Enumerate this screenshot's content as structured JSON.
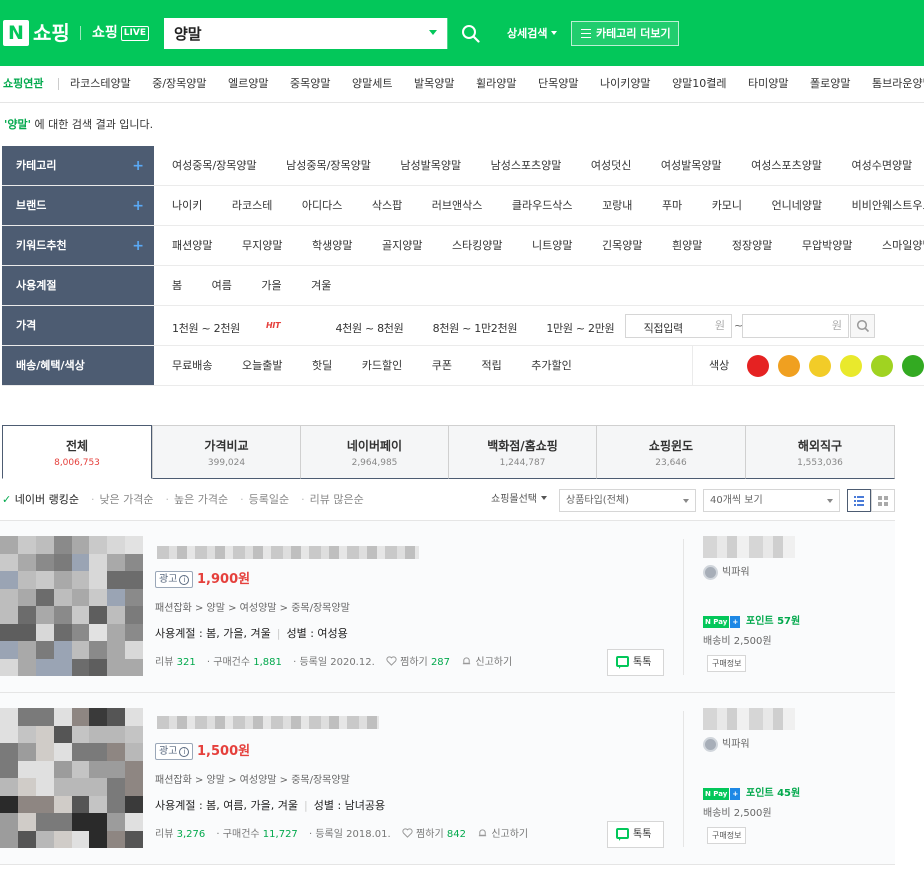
{
  "header": {
    "logo_n": "N",
    "logo_shopping": "쇼핑",
    "logo_live_text": "쇼핑",
    "logo_live_badge": "LIVE",
    "search_value": "양말",
    "detail_search": "상세검색",
    "category_more": "카테고리 더보기",
    "accent_color": "#03c75a"
  },
  "related": {
    "label": "쇼핑연관",
    "items": [
      "라코스테양말",
      "중/장목양말",
      "엘르양말",
      "중목양말",
      "양말세트",
      "발목양말",
      "휠라양말",
      "단목양말",
      "나이키양말",
      "양말10켤레",
      "타미양말",
      "폴로양말",
      "톰브라운양말"
    ]
  },
  "result": {
    "keyword": "'양말'",
    "suffix": " 에 대한 검색 결과 입니다."
  },
  "filter": {
    "category": {
      "label": "카테고리",
      "items": [
        "여성중목/장목양말",
        "남성중목/장목양말",
        "남성발목양말",
        "남성스포츠양말",
        "여성덧신",
        "여성발목양말",
        "여성스포츠양말",
        "여성수면양말"
      ]
    },
    "brand": {
      "label": "브랜드",
      "items": [
        "나이키",
        "라코스테",
        "아디다스",
        "삭스팝",
        "러브앤삭스",
        "클라우드삭스",
        "꼬랑내",
        "푸마",
        "카모니",
        "언니네양말",
        "비비안웨스트우드"
      ]
    },
    "keyword": {
      "label": "키워드추천",
      "items": [
        "패션양말",
        "무지양말",
        "학생양말",
        "골지양말",
        "스타킹양말",
        "니트양말",
        "긴목양말",
        "흰양말",
        "정장양말",
        "무압박양말",
        "스마일양말"
      ]
    },
    "season": {
      "label": "사용계절",
      "items": [
        "봄",
        "여름",
        "가을",
        "겨울"
      ]
    },
    "price": {
      "label": "가격",
      "ranges": [
        "1천원 ~ 2천원",
        "4천원 ~ 8천원",
        "8천원 ~ 1만2천원",
        "1만원 ~ 2만원"
      ],
      "hit_badge": "HIT",
      "direct_input": "직접입력",
      "min_placeholder": "원",
      "max_placeholder": "원",
      "tilde": "~"
    },
    "delivery": {
      "label": "배송/혜택/색상",
      "items": [
        "무료배송",
        "오늘출발",
        "핫딜",
        "카드할인",
        "쿠폰",
        "적립",
        "추가할인"
      ],
      "color_label": "색상",
      "colors": [
        "#e52222",
        "#f0a020",
        "#f2cc28",
        "#e9e92c",
        "#a0d321",
        "#33aa22",
        "#a6d4ef"
      ]
    }
  },
  "tabs": [
    {
      "label": "전체",
      "count": "8,006,753"
    },
    {
      "label": "가격비교",
      "count": "399,024"
    },
    {
      "label": "네이버페이",
      "count": "2,964,985"
    },
    {
      "label": "백화점/홈쇼핑",
      "count": "1,244,787"
    },
    {
      "label": "쇼핑윈도",
      "count": "23,646"
    },
    {
      "label": "해외직구",
      "count": "1,553,036"
    }
  ],
  "sort": {
    "check": "✓",
    "options": [
      "네이버 랭킹순",
      "낮은 가격순",
      "높은 가격순",
      "등록일순",
      "리뷰 많은순"
    ],
    "mall_select": "쇼핑몰선택",
    "product_type": "상품타입(전체)",
    "per_page": "40개씩 보기"
  },
  "products": [
    {
      "ad": "광고",
      "price": "1,900원",
      "categories": "패션잡화 > 양말 > 여성양말 > 중목/장목양말",
      "season_label": "사용계절 : 봄, 가을, 겨울",
      "gender_label": "성별 : 여성용",
      "review_label": "리뷰",
      "review_count": "321",
      "purchase_label": "구매건수",
      "purchase_count": "1,881",
      "registered": "등록일 2020.12.",
      "zzim_label": "찜하기",
      "zzim_count": "287",
      "report": "신고하기",
      "talk": "톡톡",
      "seller_grade": "빅파워",
      "npay_n": "N Pay",
      "npay_plus": "+",
      "point": "포인트 57원",
      "shipping": "배송비 2,500원",
      "buy_info": "구매정보"
    },
    {
      "ad": "광고",
      "price": "1,500원",
      "categories": "패션잡화 > 양말 > 여성양말 > 중목/장목양말",
      "season_label": "사용계절 : 봄, 여름, 가을, 겨울",
      "gender_label": "성별 : 남녀공용",
      "review_label": "리뷰",
      "review_count": "3,276",
      "purchase_label": "구매건수",
      "purchase_count": "11,727",
      "registered": "등록일 2018.01.",
      "zzim_label": "찜하기",
      "zzim_count": "842",
      "report": "신고하기",
      "talk": "톡톡",
      "seller_grade": "빅파워",
      "npay_n": "N Pay",
      "npay_plus": "+",
      "point": "포인트 45원",
      "shipping": "배송비 2,500원",
      "buy_info": "구매정보"
    }
  ]
}
